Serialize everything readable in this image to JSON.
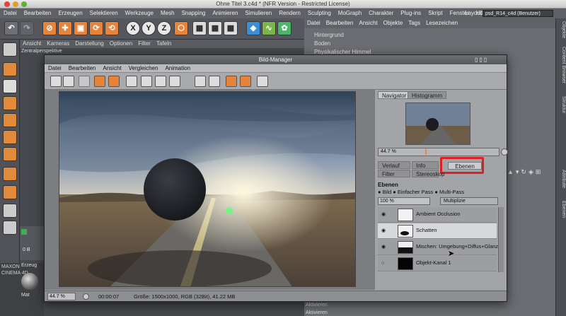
{
  "window": {
    "title": "Ohne Titel 3.c4d * (NFR Version - Restricted License)"
  },
  "menu": [
    "Datei",
    "Bearbeiten",
    "Erzeugen",
    "Selektieren",
    "Werkzeuge",
    "Mesh",
    "Snapping",
    "Animieren",
    "Simulieren",
    "Rendern",
    "Sculpting",
    "MoGraph",
    "Charakter",
    "Plug-ins",
    "Skript",
    "Fenster",
    "Hilfe"
  ],
  "layout": {
    "label": "Layout:",
    "value": "psd_R14_c4d (Benutzer)"
  },
  "toolbar": {
    "x": "X",
    "y": "Y",
    "z": "Z"
  },
  "viewport": {
    "menu": [
      "Ansicht",
      "Kameras",
      "Darstellung",
      "Optionen",
      "Filter",
      "Tafeln"
    ],
    "label": "Zentralperspektive",
    "frame": "0 B",
    "field": "0 B"
  },
  "objects": {
    "menu": [
      "Datei",
      "Bearbeiten",
      "Ansicht",
      "Objekte",
      "Tags",
      "Lesezeichen"
    ],
    "items": [
      "Hintergrund",
      "Boden",
      "Physikalischer Himmel"
    ]
  },
  "side_tabs": [
    "Objekte",
    "Content Browser",
    "Struktur",
    "Attribute",
    "Ebenen"
  ],
  "attributes": {
    "rows": [
      "Aktivieren",
      "Aktivieren"
    ]
  },
  "lower": {
    "erzeugen": "Erzeug",
    "mat": "Mat",
    "maxon": "MAXON",
    "c4d": "CINEMA 4D"
  },
  "bm": {
    "title": "Bild-Manager",
    "menu": [
      "Datei",
      "Bearbeiten",
      "Ansicht",
      "Vergleichen",
      "Animation"
    ],
    "status": {
      "zoom": "44.7 %",
      "time": "00:00:07",
      "info": "Größe: 1500x1000, RGB (32Bit), 41.22 MB"
    },
    "tabs_top": [
      "Navigator",
      "Histogramm"
    ],
    "nav_zoom": "44.7 %",
    "tabs_mid": [
      "Verlauf",
      "Info",
      "Ebenen",
      "Filter",
      "Stereoskop"
    ],
    "layers": {
      "header": "Ebenen",
      "modes": [
        "Bild",
        "Einfacher Pass",
        "Multi-Pass"
      ],
      "opacity": "100 %",
      "blend": "Multiplizie",
      "items": [
        "Ambient Occlusion",
        "Schatten",
        "Mischen: Umgebung+Diffus+Glanz",
        "Objekt-Kanal 1"
      ]
    }
  },
  "colors": {
    "accent": "#e8843a",
    "highlight": "#e02020"
  }
}
